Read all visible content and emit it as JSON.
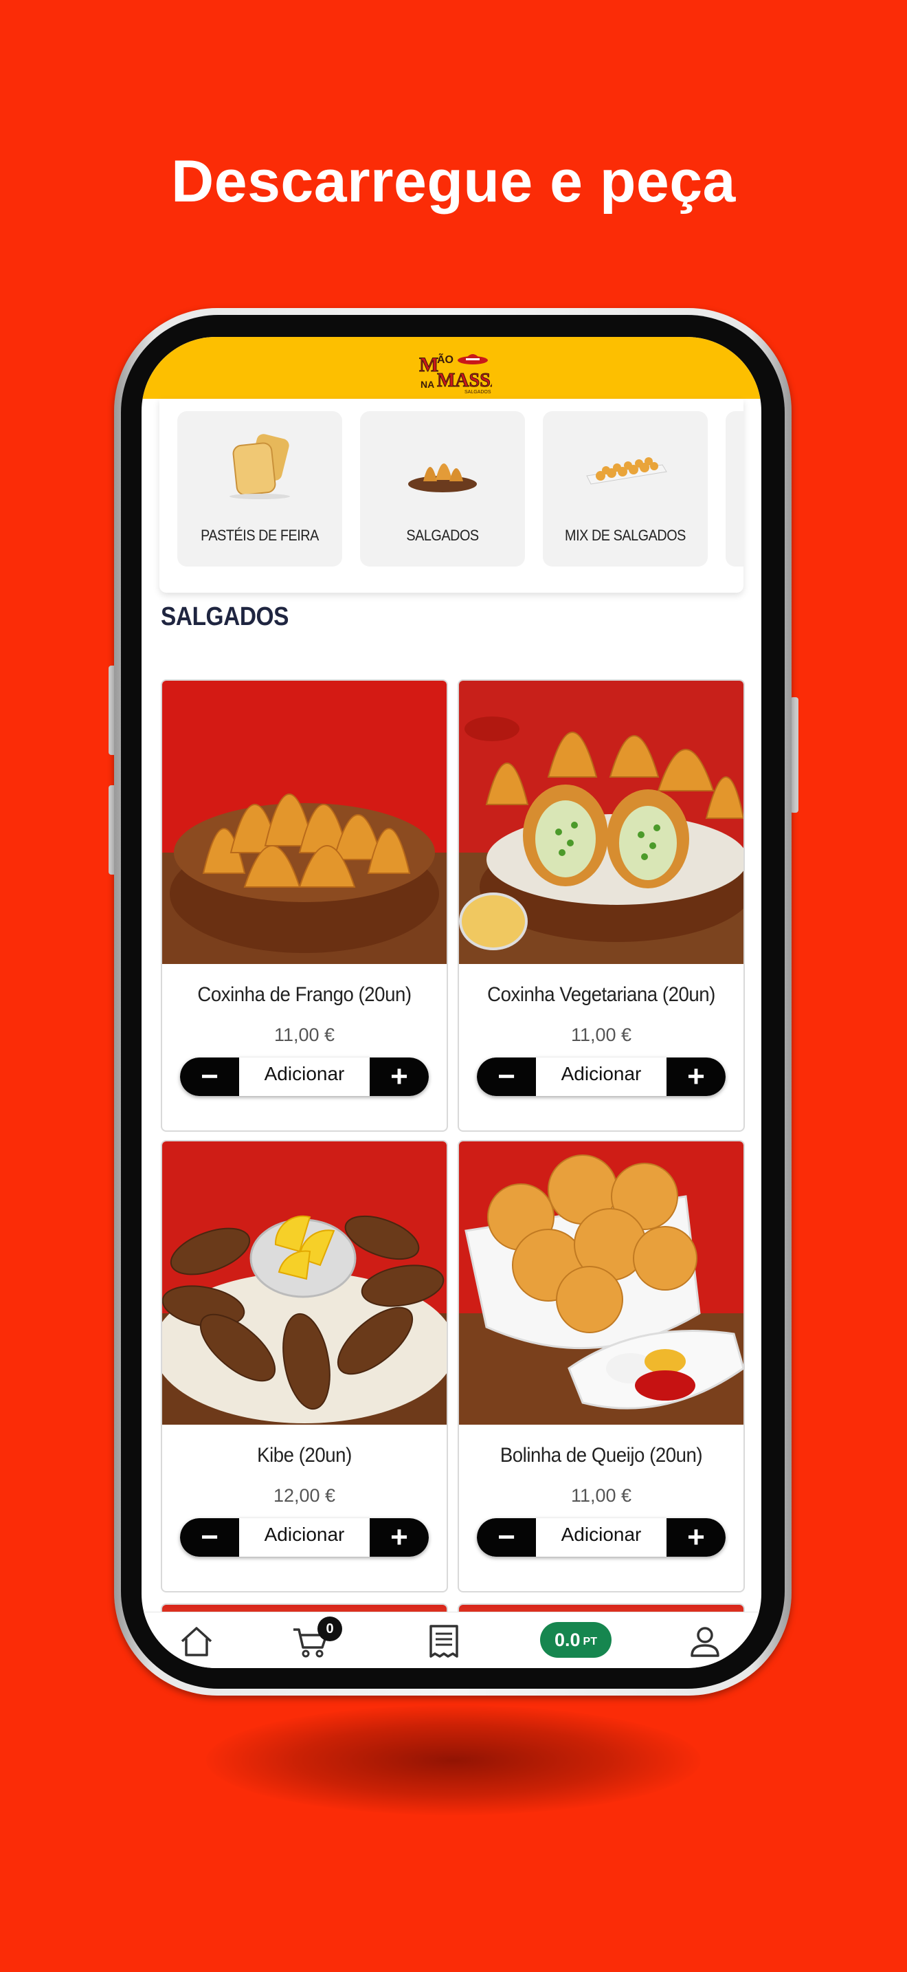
{
  "headline": "Descarregue e peça",
  "app": {
    "logo_text": "MÃO NA MASSA SALGADOS",
    "brand_color": "#fdbf00",
    "accent_color": "#16864f",
    "background_color": "#fb2c07"
  },
  "categories": [
    {
      "label": "PASTÉIS DE FEIRA",
      "icon": "pastel-image"
    },
    {
      "label": "SALGADOS",
      "icon": "salgados-image"
    },
    {
      "label": "MIX DE SALGADOS",
      "icon": "mix-salgados-image"
    }
  ],
  "section_title": "SALGADOS",
  "products": [
    {
      "name": "Coxinha de Frango (20un)",
      "price": "11,00 €",
      "add_label": "Adicionar"
    },
    {
      "name": "Coxinha Vegetariana (20un)",
      "price": "11,00 €",
      "add_label": "Adicionar"
    },
    {
      "name": "Kibe (20un)",
      "price": "12,00 €",
      "add_label": "Adicionar"
    },
    {
      "name": "Bolinha de Queijo (20un)",
      "price": "11,00 €",
      "add_label": "Adicionar"
    }
  ],
  "bottom_nav": {
    "home_icon": "home-icon",
    "cart_icon": "cart-icon",
    "cart_count": "0",
    "orders_icon": "receipt-icon",
    "points_value": "0.0",
    "points_unit": "PT",
    "profile_icon": "user-icon"
  }
}
